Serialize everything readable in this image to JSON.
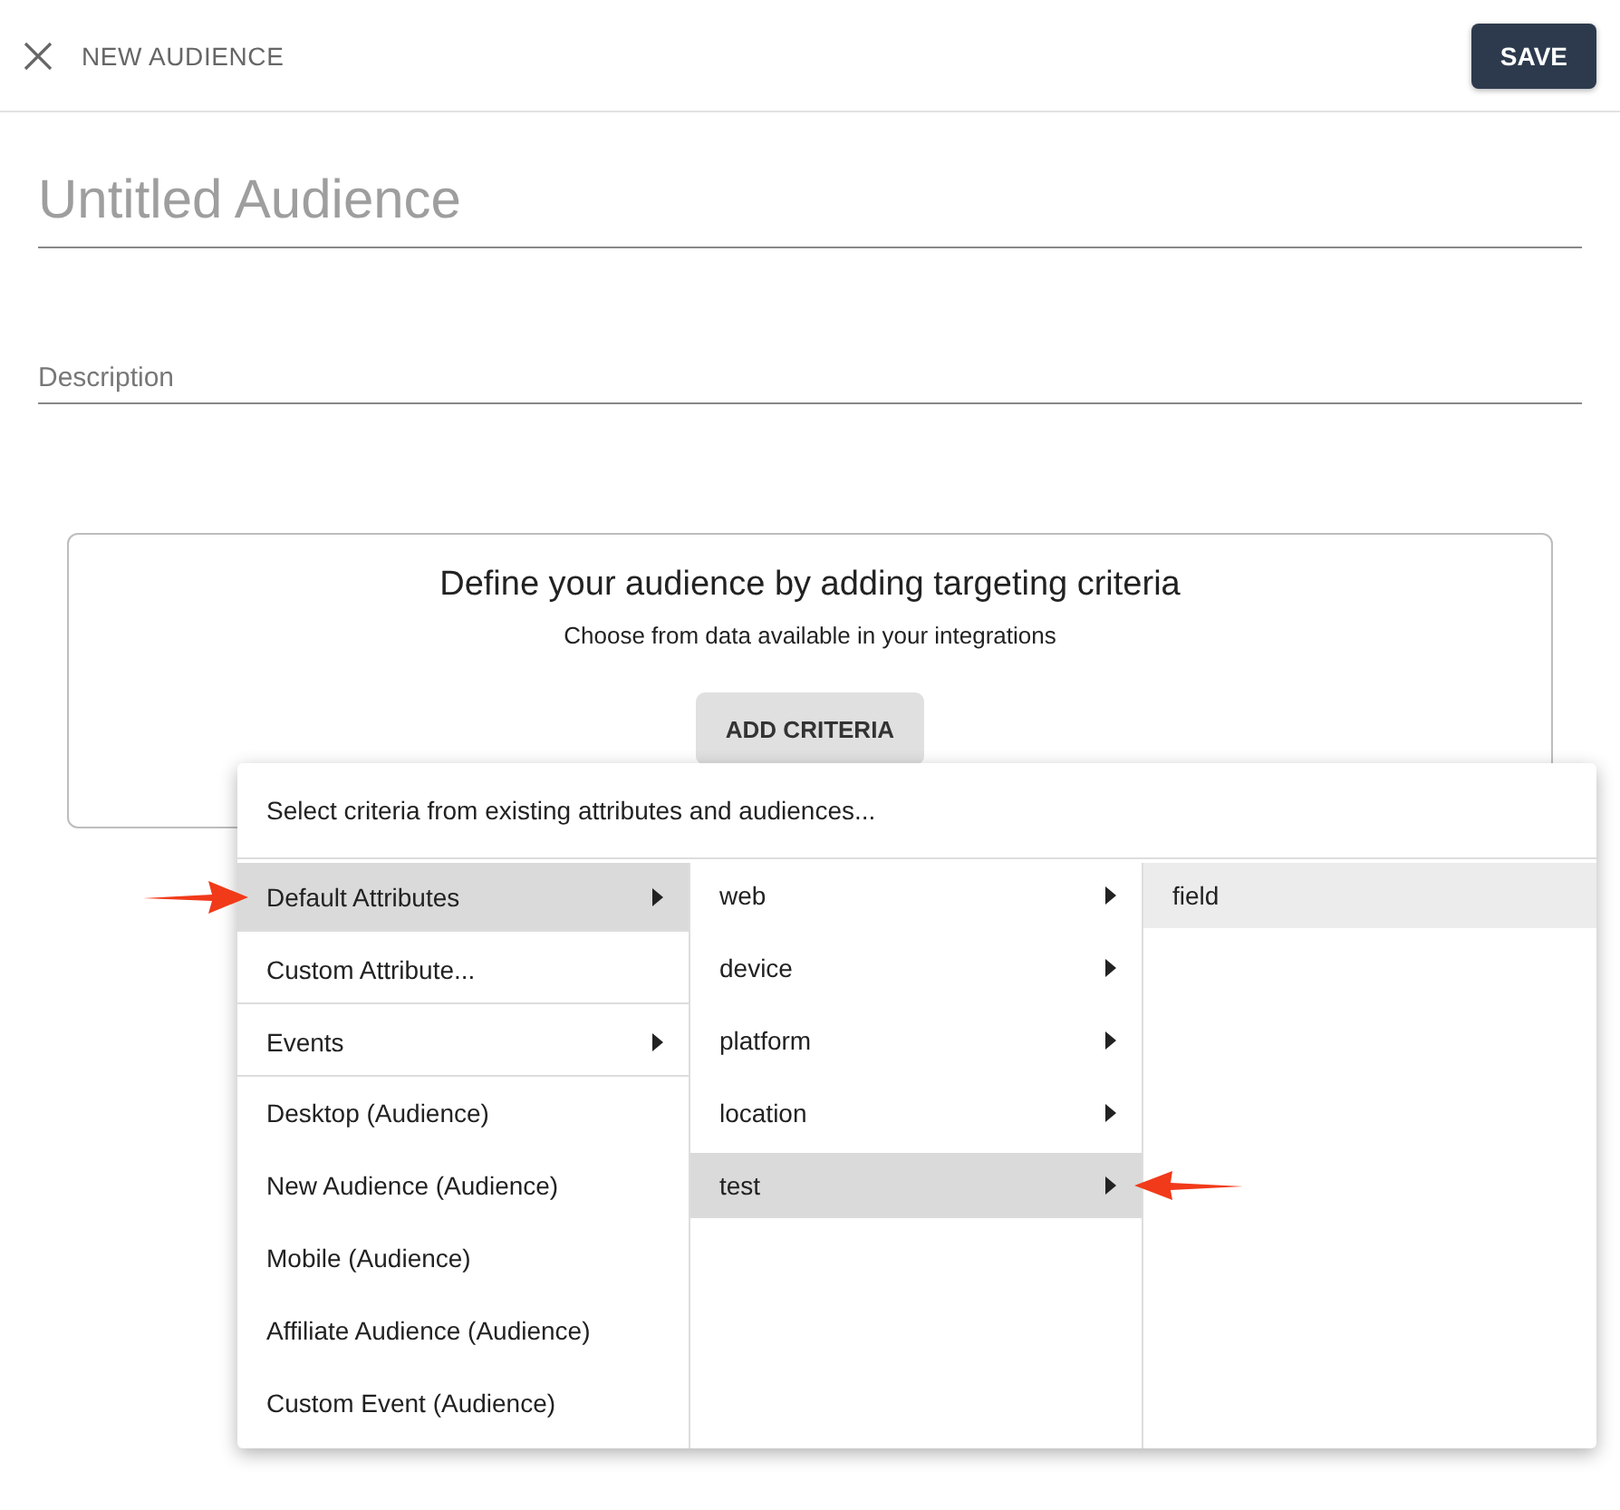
{
  "header": {
    "title": "NEW AUDIENCE",
    "save_button": "SAVE"
  },
  "name_field": {
    "placeholder": "Untitled Audience"
  },
  "description_field": {
    "placeholder": "Description"
  },
  "criteria_card": {
    "heading": "Define your audience by adding targeting criteria",
    "subheading": "Choose from data available in your integrations",
    "button": "ADD CRITERIA"
  },
  "menu": {
    "prompt": "Select criteria from existing attributes and audiences...",
    "columns": [
      [
        {
          "label": "Default Attributes",
          "kind": "submenu",
          "selected": true,
          "divider": true,
          "pointer": true
        },
        {
          "label": "Custom Attribute...",
          "kind": "action",
          "selected": false,
          "divider": true,
          "pointer": false
        },
        {
          "label": "Events",
          "kind": "submenu",
          "selected": false,
          "divider": true,
          "pointer": false
        },
        {
          "label": "Desktop (Audience)",
          "kind": "action",
          "selected": false,
          "divider": false,
          "pointer": false
        },
        {
          "label": "New Audience (Audience)",
          "kind": "action",
          "selected": false,
          "divider": false,
          "pointer": false
        },
        {
          "label": "Mobile (Audience)",
          "kind": "action",
          "selected": false,
          "divider": false,
          "pointer": false
        },
        {
          "label": "Affiliate Audience (Audience)",
          "kind": "action",
          "selected": false,
          "divider": false,
          "pointer": false
        },
        {
          "label": "Custom Event (Audience)",
          "kind": "action",
          "selected": false,
          "divider": false,
          "pointer": false
        }
      ],
      [
        {
          "label": "web",
          "kind": "submenu",
          "selected": false,
          "divider": false,
          "pointer": false
        },
        {
          "label": "device",
          "kind": "submenu",
          "selected": false,
          "divider": false,
          "pointer": false
        },
        {
          "label": "platform",
          "kind": "submenu",
          "selected": false,
          "divider": false,
          "pointer": false
        },
        {
          "label": "location",
          "kind": "submenu",
          "selected": false,
          "divider": false,
          "pointer": false
        },
        {
          "label": "test",
          "kind": "submenu",
          "selected": true,
          "divider": false,
          "pointer": true
        }
      ],
      [
        {
          "label": "field",
          "kind": "action",
          "selected": true,
          "divider": false,
          "pointer": false
        }
      ]
    ]
  }
}
